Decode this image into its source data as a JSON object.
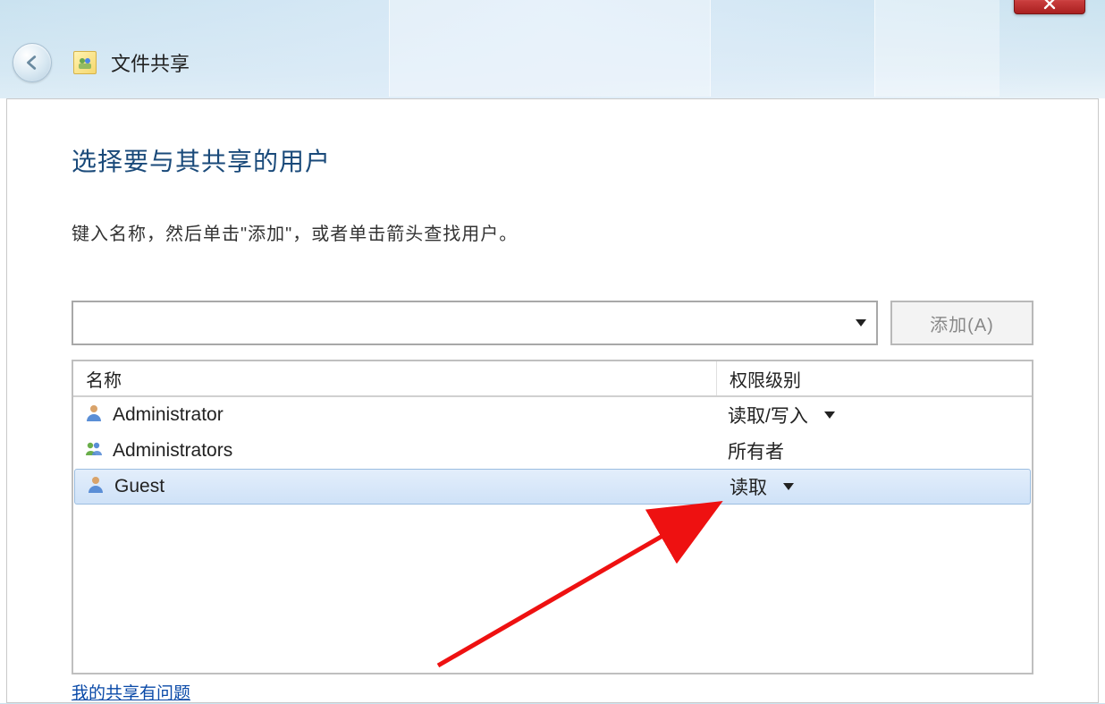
{
  "window": {
    "title": "文件共享"
  },
  "dialog": {
    "heading": "选择要与其共享的用户",
    "subtext": "键入名称，然后单击\"添加\"，或者单击箭头查找用户。",
    "user_input_value": "",
    "add_button_label": "添加(A)",
    "columns": {
      "name": "名称",
      "permission": "权限级别"
    },
    "rows": [
      {
        "name": "Administrator",
        "permission": "读取/写入",
        "has_dropdown": true,
        "icon": "user",
        "selected": false
      },
      {
        "name": "Administrators",
        "permission": "所有者",
        "has_dropdown": false,
        "icon": "group",
        "selected": false
      },
      {
        "name": "Guest",
        "permission": "读取",
        "has_dropdown": true,
        "icon": "user",
        "selected": true
      }
    ],
    "help_link": "我的共享有问题"
  }
}
